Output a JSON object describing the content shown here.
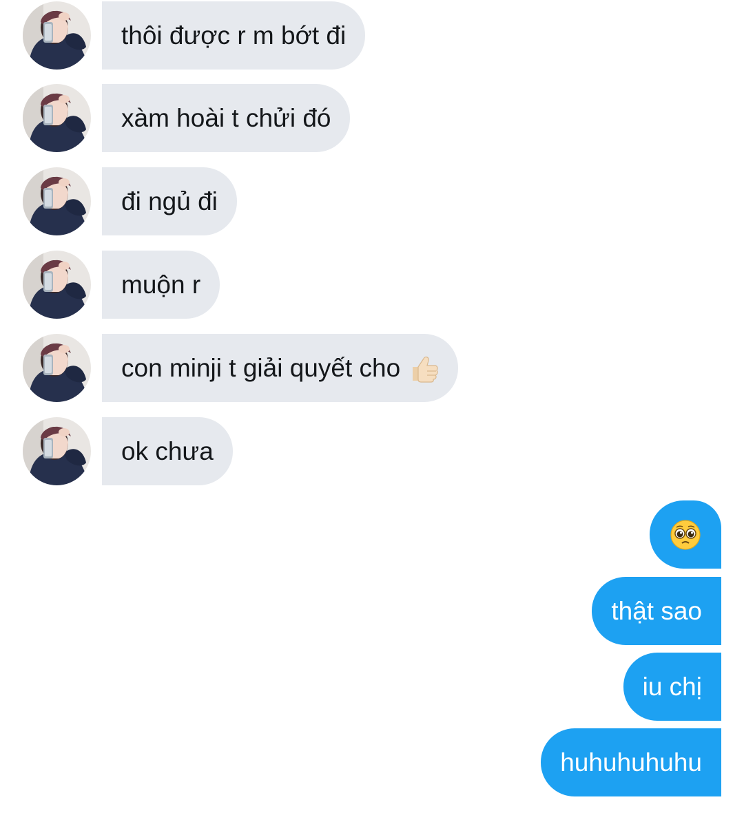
{
  "received_messages": [
    {
      "text": "thôi được r m bớt đi"
    },
    {
      "text": "xàm hoài t chửi đó"
    },
    {
      "text": "đi ngủ đi"
    },
    {
      "text": "muộn r"
    },
    {
      "text": "con minji t giải quyết cho",
      "emoji": "thumbs-up-light-skin-icon"
    },
    {
      "text": "ok chưa"
    }
  ],
  "sent_messages": [
    {
      "emoji": "pleading-face-icon"
    },
    {
      "text": "thật sao"
    },
    {
      "text": "iu chị"
    },
    {
      "text": "huhuhuhuhu"
    }
  ],
  "colors": {
    "received_bubble": "#e6e9ee",
    "received_text": "#14171a",
    "sent_bubble": "#1da1f2",
    "sent_text": "#ffffff"
  }
}
